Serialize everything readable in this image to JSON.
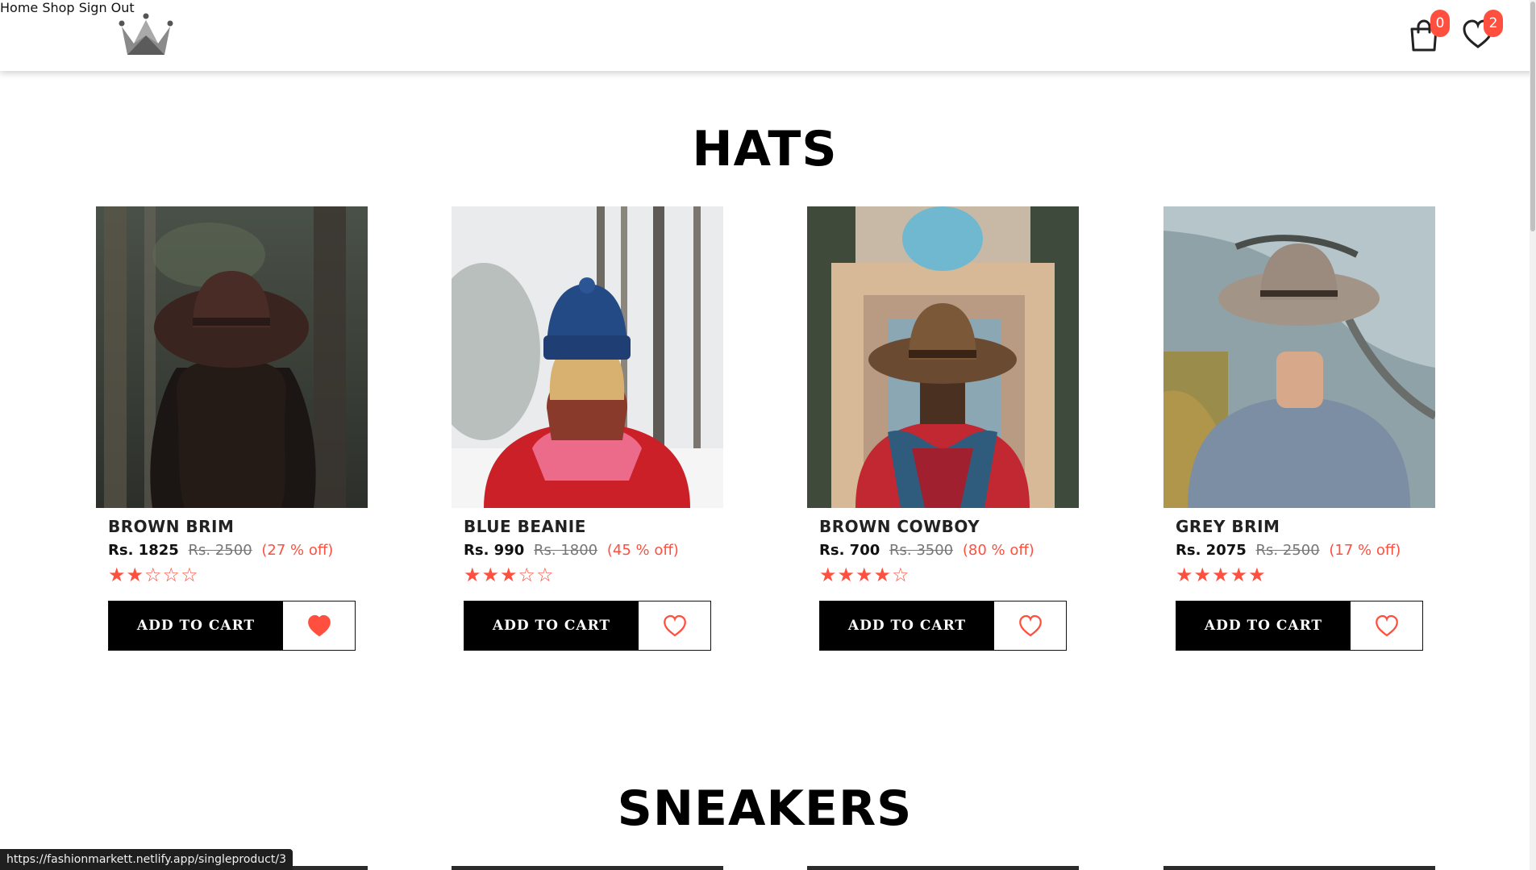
{
  "header": {
    "nav": {
      "home": "Home",
      "shop": "Shop",
      "sign_out": "Sign Out"
    },
    "cart_count": "0",
    "wishlist_count": "2",
    "logo_icon": "crown-icon"
  },
  "sections": [
    {
      "title": "HATS"
    },
    {
      "title": "SNEAKERS"
    }
  ],
  "products": [
    {
      "name": "BROWN BRIM",
      "price": "Rs. 1825",
      "old_price": "Rs. 2500",
      "discount": "(27 % off)",
      "rating": 2,
      "stars": "★★☆☆☆",
      "wishlisted": true,
      "cart_label": "ADD TO CART"
    },
    {
      "name": "BLUE BEANIE",
      "price": "Rs. 990",
      "old_price": "Rs. 1800",
      "discount": "(45 % off)",
      "rating": 3,
      "stars": "★★★☆☆",
      "wishlisted": false,
      "cart_label": "ADD TO CART"
    },
    {
      "name": "BROWN COWBOY",
      "price": "Rs. 700",
      "old_price": "Rs. 3500",
      "discount": "(80 % off)",
      "rating": 4,
      "stars": "★★★★☆",
      "wishlisted": false,
      "cart_label": "ADD TO CART"
    },
    {
      "name": "GREY BRIM",
      "price": "Rs. 2075",
      "old_price": "Rs. 2500",
      "discount": "(17 % off)",
      "rating": 5,
      "stars": "★★★★★",
      "wishlisted": false,
      "cart_label": "ADD TO CART"
    }
  ],
  "status_url": "https://fashionmarkett.netlify.app/singleproduct/3",
  "colors": {
    "accent": "#ff4f3f",
    "button": "#000000"
  }
}
